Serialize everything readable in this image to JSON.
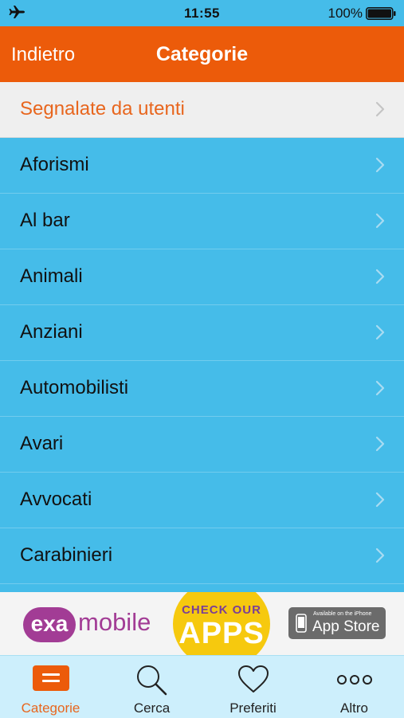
{
  "status_bar": {
    "icon": "airplane-icon",
    "time": "11:55",
    "battery_percent": "100%",
    "battery_level": 1.0
  },
  "nav": {
    "back_label": "Indietro",
    "title": "Categorie"
  },
  "list": {
    "highlight": {
      "label": "Segnalate da utenti"
    },
    "items": [
      {
        "label": "Aforismi"
      },
      {
        "label": "Al bar"
      },
      {
        "label": "Animali"
      },
      {
        "label": "Anziani"
      },
      {
        "label": "Automobilisti"
      },
      {
        "label": "Avari"
      },
      {
        "label": "Avvocati"
      },
      {
        "label": "Carabinieri"
      }
    ]
  },
  "ad": {
    "brand_pill": "exa",
    "brand_text": "mobile",
    "badge_small": "CHECK OUR",
    "badge_big": "APPS",
    "store_top": "Available on the iPhone",
    "store_main": "App Store"
  },
  "tabs": [
    {
      "label": "Categorie",
      "icon": "categories-icon",
      "active": true
    },
    {
      "label": "Cerca",
      "icon": "search-icon",
      "active": false
    },
    {
      "label": "Preferiti",
      "icon": "heart-icon",
      "active": false
    },
    {
      "label": "Altro",
      "icon": "more-icon",
      "active": false
    }
  ],
  "colors": {
    "nav_orange": "#ec5b0a",
    "list_blue": "#45bce9",
    "accent_orange": "#e8661e",
    "tab_bar_bg": "#cdeffc"
  }
}
